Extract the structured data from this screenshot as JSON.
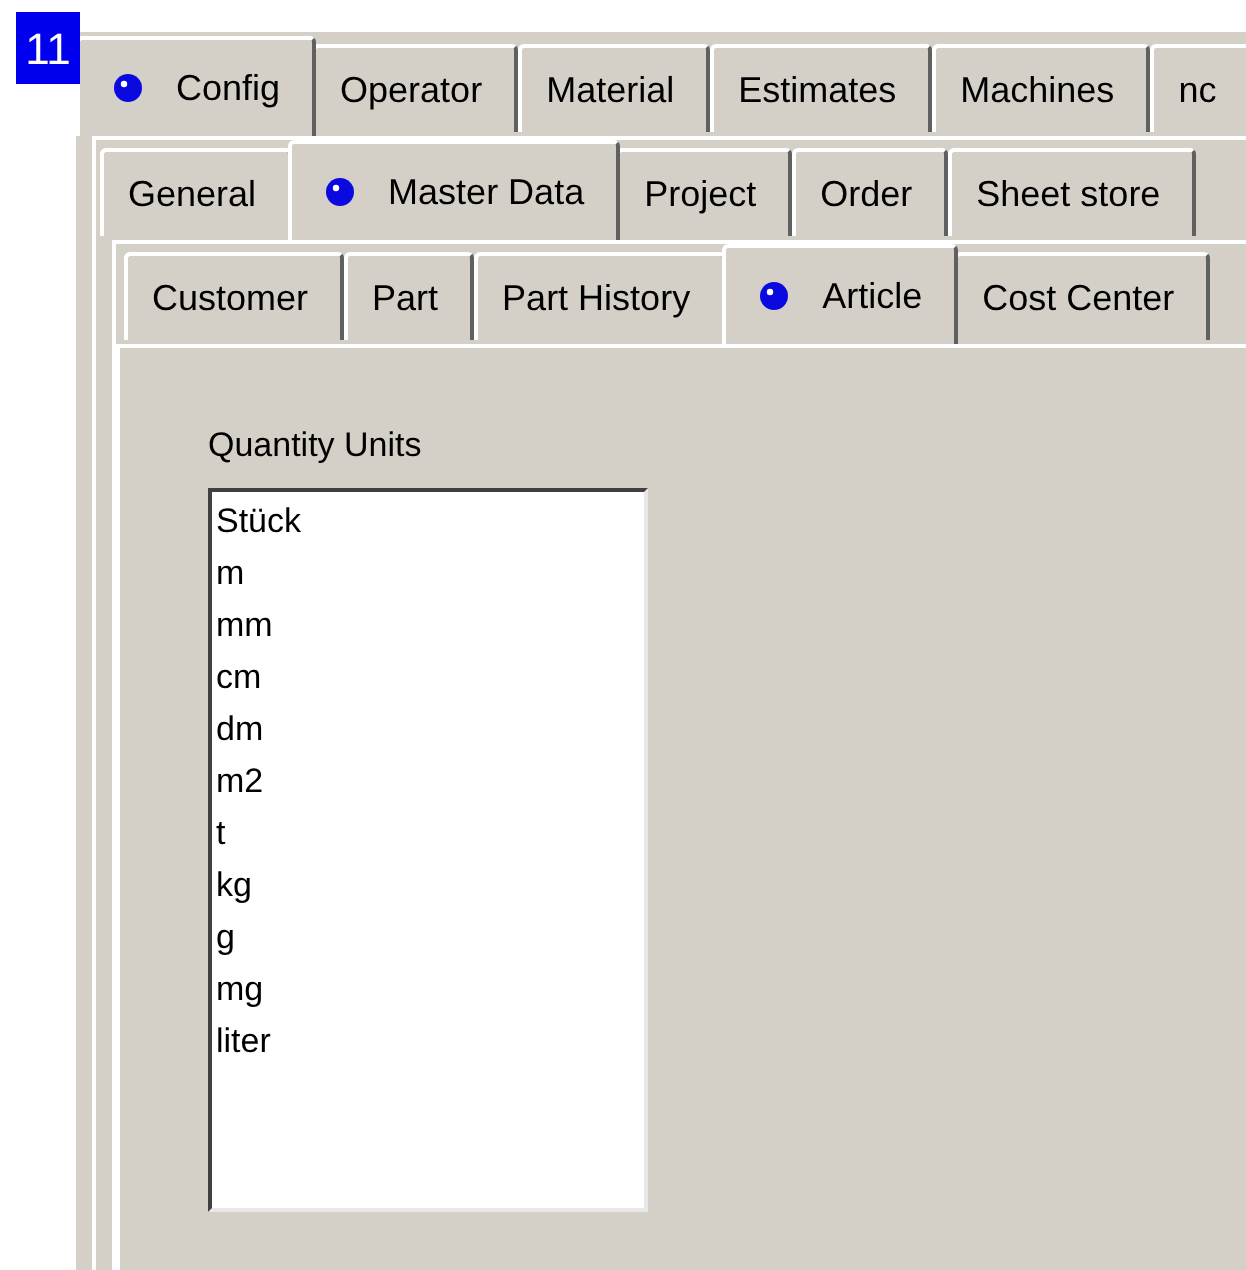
{
  "step_badge": "11",
  "tab_rows": [
    [
      {
        "label": "Config",
        "selected": true
      },
      {
        "label": "Operator",
        "selected": false
      },
      {
        "label": "Material",
        "selected": false
      },
      {
        "label": "Estimates",
        "selected": false
      },
      {
        "label": "Machines",
        "selected": false
      },
      {
        "label": "nc",
        "selected": false
      }
    ],
    [
      {
        "label": "General",
        "selected": false
      },
      {
        "label": "Master Data",
        "selected": true
      },
      {
        "label": "Project",
        "selected": false
      },
      {
        "label": "Order",
        "selected": false
      },
      {
        "label": "Sheet store",
        "selected": false
      }
    ],
    [
      {
        "label": "Customer",
        "selected": false
      },
      {
        "label": "Part",
        "selected": false
      },
      {
        "label": "Part History",
        "selected": false
      },
      {
        "label": "Article",
        "selected": true
      },
      {
        "label": "Cost Center",
        "selected": false
      }
    ]
  ],
  "quantity_units": {
    "label": "Quantity Units",
    "items": [
      "Stück",
      "m",
      "mm",
      "cm",
      "dm",
      "m2",
      "t",
      "kg",
      "g",
      "mg",
      "liter"
    ]
  }
}
